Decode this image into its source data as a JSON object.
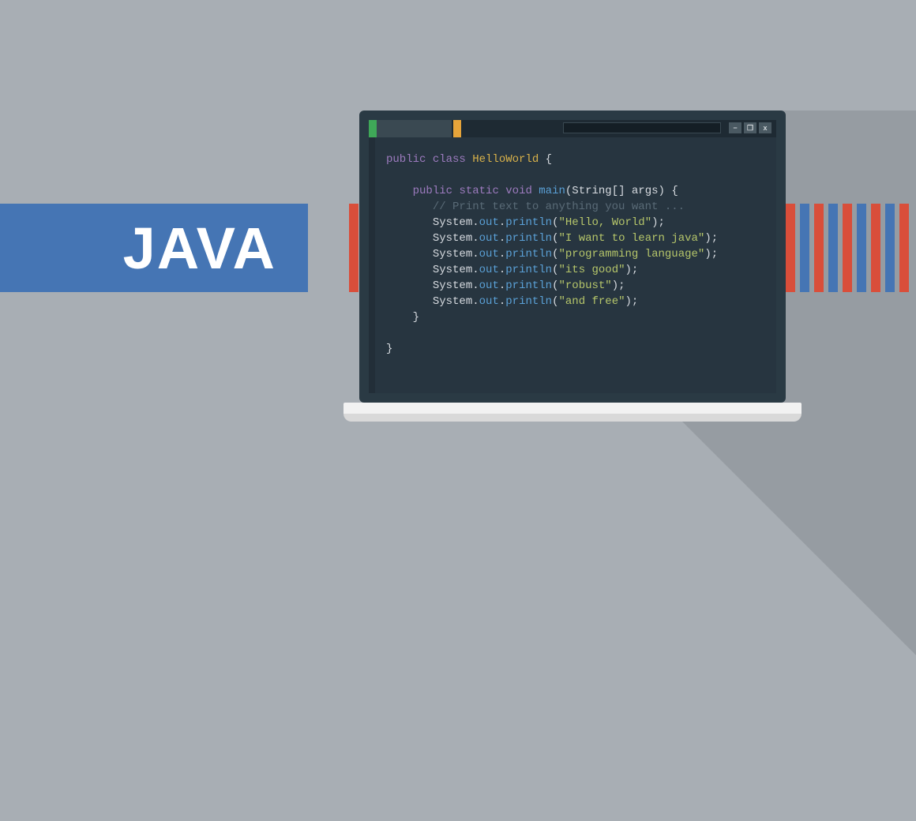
{
  "banner": {
    "title": "JAVA"
  },
  "stripes_left": [
    "red",
    "blue",
    "red"
  ],
  "stripes_right": [
    "red",
    "blue",
    "red",
    "blue",
    "red",
    "blue",
    "red",
    "blue",
    "red"
  ],
  "window": {
    "minimize": "−",
    "maximize": "❐",
    "close": "x"
  },
  "code": {
    "l1": {
      "kw1": "public",
      "kw2": "class",
      "cls": "HelloWorld",
      "open": " {"
    },
    "blank": "",
    "l2": {
      "indent": "    ",
      "kw1": "public",
      "kw2": "static",
      "kw3": "void",
      "fn": "main",
      "args": "(String[] args) {"
    },
    "l3": {
      "indent": "       ",
      "text": "// Print text to anything you want ..."
    },
    "l4": {
      "indent": "       ",
      "obj": "System",
      "dot1": ".",
      "out": "out",
      "dot2": ".",
      "fn": "println",
      "open": "(",
      "str": "\"Hello, World\"",
      "close": ");"
    },
    "l5": {
      "indent": "       ",
      "obj": "System",
      "dot1": ".",
      "out": "out",
      "dot2": ".",
      "fn": "println",
      "open": "(",
      "str": "\"I want to learn java\"",
      "close": ");"
    },
    "l6": {
      "indent": "       ",
      "obj": "System",
      "dot1": ".",
      "out": "out",
      "dot2": ".",
      "fn": "println",
      "open": "(",
      "str": "\"programming language\"",
      "close": ");"
    },
    "l7": {
      "indent": "       ",
      "obj": "System",
      "dot1": ".",
      "out": "out",
      "dot2": ".",
      "fn": "println",
      "open": "(",
      "str": "\"its good\"",
      "close": ");"
    },
    "l8": {
      "indent": "       ",
      "obj": "System",
      "dot1": ".",
      "out": "out",
      "dot2": ".",
      "fn": "println",
      "open": "(",
      "str": "\"robust\"",
      "close": ");"
    },
    "l9": {
      "indent": "       ",
      "obj": "System",
      "dot1": ".",
      "out": "out",
      "dot2": ".",
      "fn": "println",
      "open": "(",
      "str": "\"and free\"",
      "close": ");"
    },
    "l10": {
      "indent": "    ",
      "brace": "}"
    },
    "l11": {
      "indent": "",
      "brace": "}"
    }
  }
}
